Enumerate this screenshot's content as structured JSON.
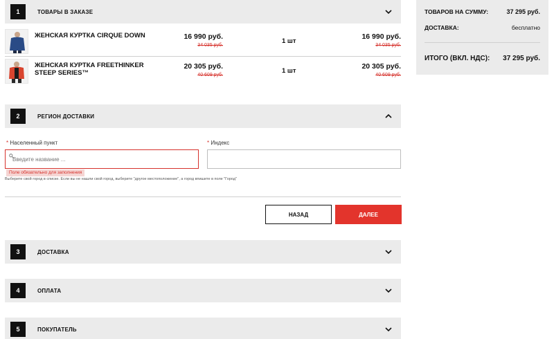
{
  "steps": [
    {
      "num": "1",
      "title": "ТОВАРЫ В ЗАКАЗЕ"
    },
    {
      "num": "2",
      "title": "РЕГИОН ДОСТАВКИ"
    },
    {
      "num": "3",
      "title": "ДОСТАВКА"
    },
    {
      "num": "4",
      "title": "ОПЛАТА"
    },
    {
      "num": "5",
      "title": "ПОКУПАТЕЛЬ"
    }
  ],
  "products": [
    {
      "name": "ЖЕНСКАЯ КУРТКА CIRQUE DOWN",
      "price": "16 990 руб.",
      "old_price": "34 035 руб.",
      "qty": "1 шт",
      "total": "16 990 руб.",
      "total_old": "34 035 руб."
    },
    {
      "name": "ЖЕНСКАЯ КУРТКА FREETHINKER STEEP SERIES™",
      "price": "20 305 руб.",
      "old_price": "40 609 руб.",
      "qty": "1 шт",
      "total": "20 305 руб.",
      "total_old": "40 609 руб."
    }
  ],
  "region": {
    "city_label": "Населенный пункт",
    "city_placeholder": "Введите название ...",
    "city_value": "",
    "index_label": "Индекс",
    "index_value": "",
    "required_mark": "*",
    "error": "Поле обязательно для заполнения",
    "hint": "Выберите свой город в списке. Если вы не нашли свой город, выберите \"другое местоположение\", а город впишите в поле \"Город\""
  },
  "buttons": {
    "back": "НАЗАД",
    "next": "ДАЛЕЕ"
  },
  "summary": {
    "goods_label": "ТОВАРОВ НА СУММУ:",
    "goods_value": "37 295 руб.",
    "delivery_label": "ДОСТАВКА:",
    "delivery_value": "бесплатно",
    "total_label": "ИТОГО (ВКЛ. НДС):",
    "total_value": "37 295 руб."
  },
  "colors": {
    "accent": "#e3342c",
    "error": "#d6312b",
    "panel": "#ebebeb"
  },
  "icons": {
    "collapse": "chevron-up-icon",
    "expand": "chevron-down-icon",
    "search": "search-icon"
  }
}
